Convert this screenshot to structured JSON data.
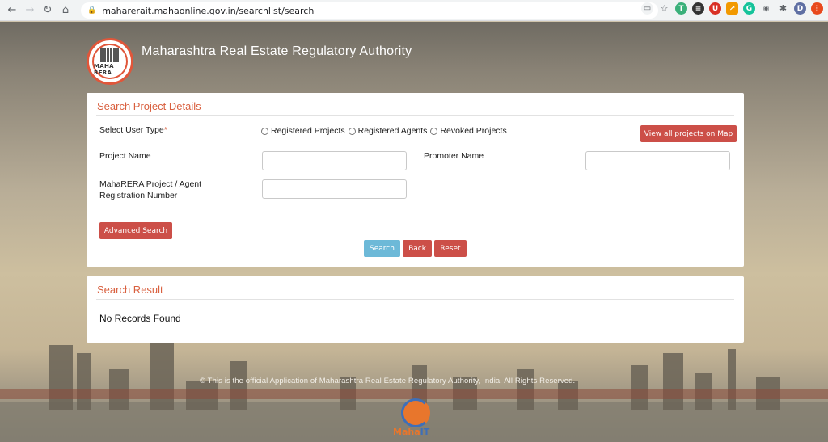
{
  "browser": {
    "url": "maharerait.mahaonline.gov.in/searchlist/search",
    "profile_initial": "D"
  },
  "header": {
    "title": "Maharashtra Real Estate Regulatory Authority",
    "logo_text": "MAHA RERA"
  },
  "search_panel": {
    "title": "Search Project Details",
    "user_type_label": "Select User Type",
    "required_marker": "*",
    "radio_options": [
      "Registered Projects",
      "Registered Agents",
      "Revoked Projects"
    ],
    "map_button": "View all projects on Map",
    "project_name_label": "Project Name",
    "promoter_name_label": "Promoter Name",
    "registration_label_line1": "MahaRERA Project / Agent",
    "registration_label_line2": "Registration Number",
    "advanced_search_button": "Advanced Search",
    "search_button": "Search",
    "back_button": "Back",
    "reset_button": "Reset"
  },
  "result_panel": {
    "title": "Search Result",
    "message": "No Records Found"
  },
  "footer": {
    "text": "© This is the official Application of Maharashtra Real Estate Regulatory Authority, India. All Rights Reserved.",
    "mahait_a": "Maha",
    "mahait_b": "IT"
  },
  "colors": {
    "accent": "#d9603f",
    "button_red": "#cc4f48",
    "button_blue": "#6db9d8"
  }
}
